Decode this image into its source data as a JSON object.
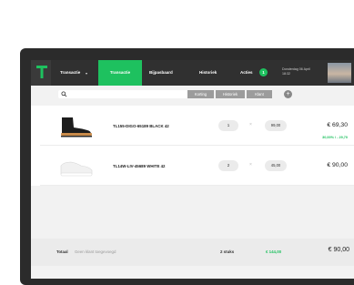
{
  "nav": {
    "transactie": "Transactie",
    "tabs": [
      {
        "label": "Transactie",
        "active": true
      },
      {
        "label": "Bijpasbaard",
        "active": false
      },
      {
        "label": "Historiek",
        "active": false
      },
      {
        "label": "Acties",
        "active": false
      }
    ],
    "acties_badge": "1",
    "date_line1": "Donderdag 06 April",
    "date_line2": "18:32",
    "accent_color": "#1ec15f"
  },
  "search": {
    "placeholder": "",
    "filters": [
      "Korting",
      "Historiek",
      "Klant"
    ],
    "add_symbol": "+"
  },
  "items": [
    {
      "name": "TL155-DIGO-65189 BLACK 42",
      "qty": "1",
      "unit_price": "99,00",
      "total": "€ 69,30",
      "discount": "30,00% / - 29,70",
      "image": "black-boot-icon"
    },
    {
      "name": "TL14W-LIV-45689 WHITE 42",
      "qty": "2",
      "unit_price": "45,00",
      "total": "€ 90,00",
      "discount": "",
      "image": "white-sneaker-icon"
    }
  ],
  "times_symbol": "×",
  "footer": {
    "label": "Totaal",
    "note": "Geen klant toegevoegd",
    "count": "2 stuks",
    "green_total": "€ 144,00",
    "total": "€ 90,00"
  }
}
